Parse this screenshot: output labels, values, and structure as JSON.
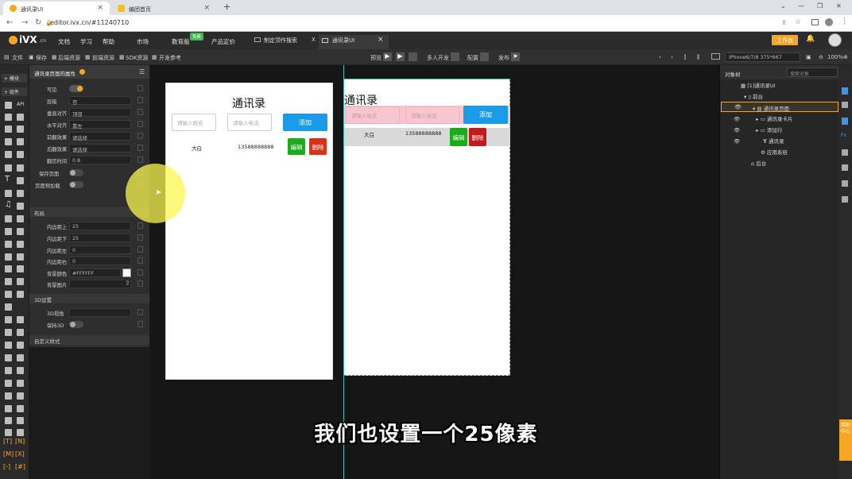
{
  "browser": {
    "tabs": [
      {
        "title": "通讯录UI",
        "close": "×"
      },
      {
        "title": "编团首页",
        "close": "×"
      }
    ],
    "new_tab": "+",
    "url": "editor.ivx.cn/#11240710",
    "window_controls": [
      "⌄",
      "—",
      "❐",
      "✕"
    ]
  },
  "app": {
    "logo": "iVX",
    "logo_suffix": ".cn",
    "menu": [
      "文档",
      "学习",
      "帮助",
      "市场",
      "教育版",
      "产品定价"
    ],
    "edu_badge": "免费",
    "editor_tabs": [
      {
        "title": "制定顶作搜索",
        "close": "X"
      },
      {
        "title": "通讯录UI",
        "close": "×"
      }
    ],
    "workbench_button": "工作台"
  },
  "toolbar": {
    "left": [
      "文件",
      "保存",
      "后端资源",
      "前端资源",
      "SDK资源",
      "开发参考"
    ],
    "center": [
      "预览",
      "多人开发",
      "配置",
      "发布"
    ],
    "device": "iPhone6/7/8 375*667",
    "zoom": "100%"
  },
  "sidebar_tabs": [
    "+ 模块",
    "+ 组件"
  ],
  "props": {
    "title": "通讯录页面的属性",
    "rows": [
      {
        "label": "可见",
        "type": "toggle",
        "on": true
      },
      {
        "label": "层级",
        "value": "否"
      },
      {
        "label": "垂直对齐",
        "value": "顶部"
      },
      {
        "label": "水平对齐",
        "value": "靠左"
      },
      {
        "label": "前翻效果",
        "value": "请选择"
      },
      {
        "label": "后翻效果",
        "value": "请选择"
      },
      {
        "label": "翻页时间",
        "value": "0.8"
      },
      {
        "label": "保存页面",
        "type": "toggle",
        "on": false
      },
      {
        "label": "页面预加载",
        "type": "toggle",
        "on": false
      }
    ],
    "section_layout": "布局",
    "layout_rows": [
      {
        "label": "内边距上",
        "value": "25"
      },
      {
        "label": "内边距下",
        "value": "25"
      },
      {
        "label": "内边距左",
        "value": "0"
      },
      {
        "label": "内边距右",
        "value": "0"
      },
      {
        "label": "背景颜色",
        "value": "#FFFFFF"
      },
      {
        "label": "背景图片",
        "value": ""
      }
    ],
    "section_3d": "3D设置",
    "rows_3d": [
      {
        "label": "3D视角",
        "value": ""
      },
      {
        "label": "保持3D",
        "type": "toggle",
        "on": false
      }
    ],
    "section_custom": "自定义样式"
  },
  "phone_left": {
    "title": "通讯录",
    "name_placeholder": "请输入姓名",
    "phone_placeholder": "请输入电话",
    "add_button": "添加",
    "row": {
      "name": "大白",
      "phone": "13588888888",
      "edit": "编辑",
      "delete": "删除"
    }
  },
  "phone_right": {
    "title": "通讯录",
    "name_placeholder": "请输入姓名",
    "phone_placeholder": "请输入电话",
    "add_button": "添加",
    "row": {
      "name": "大白",
      "phone": "13588888888",
      "edit": "编辑",
      "delete": "删除"
    }
  },
  "tree": {
    "header": "对象树",
    "search_placeholder": "搜索对象",
    "items": [
      {
        "label": "[1]通讯录UI",
        "indent": 0
      },
      {
        "label": "前台",
        "indent": 1
      },
      {
        "label": "通讯录页面",
        "indent": 2
      },
      {
        "label": "通讯录卡片",
        "indent": 3
      },
      {
        "label": "添加行",
        "indent": 3
      },
      {
        "label": "通讯录",
        "indent": 3
      },
      {
        "label": "应用系统",
        "indent": 2
      },
      {
        "label": "后台",
        "indent": 1
      }
    ]
  },
  "right_badge": "帮助中心",
  "subtitle": "我们也设置一个25像素",
  "colors": {
    "accent_orange": "#f5a623",
    "button_blue": "#1a9be8",
    "edit_green": "#1aad19",
    "delete_red": "#d9301a"
  }
}
